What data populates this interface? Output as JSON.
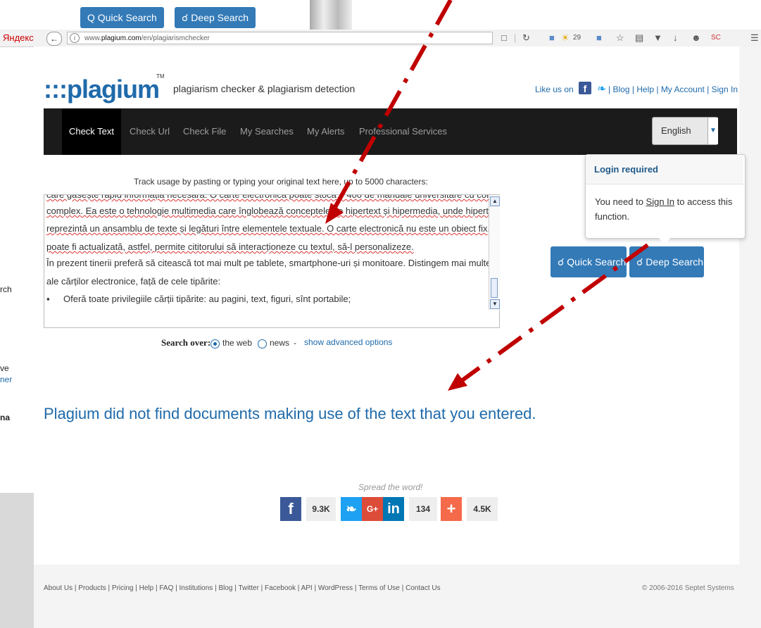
{
  "background": {
    "top_buttons": [
      "Q Quick Search",
      "Deep Search"
    ],
    "left_fragments": [
      "rch",
      "ve",
      "ner",
      "na"
    ]
  },
  "browser": {
    "yandex": "Яндекс",
    "url_prefix": "www.",
    "url_domain": "plagium.com",
    "url_path": "/en/plagiarismchecker",
    "weather": "29"
  },
  "header": {
    "logo": ":::plagium",
    "tm": "TM",
    "tagline": "plagiarism checker & plagiarism detection",
    "like_us": "Like us on",
    "links": [
      "Blog",
      "Help",
      "My Account",
      "Sign In"
    ]
  },
  "nav": {
    "items": [
      "Check Text",
      "Check Url",
      "Check File",
      "My Searches",
      "My Alerts",
      "Professional Services"
    ],
    "language": "English"
  },
  "input": {
    "label": "Track usage by pasting or typing your original text here, up to 5000 characters:",
    "lines": [
      "care găsește rapid informația necesară. O carte electronică poate stoca o 400 de manuale universitare cu conținut",
      "complex. Ea este o tehnologie multimedia care înglobează conceptele de hipertext și hipermedia, unde hipertextul",
      "reprezintă un ansamblu de texte și legături între elementele textuale. O carte electronică nu este un obiect fix, ea",
      "poate fi actualizată, astfel, permite cititorului să interacționeze cu textul, să-l personalizeze.",
      "În prezent tinerii preferă să citească tot mai mult pe tablete, smartphone-uri și monitoare. Distingem mai multe avantaje",
      "ale cărților electronice, față de cele tipărite:",
      "Oferă toate privilegiile cărții tipărite: au pagini, text, figuri, sînt portabile;"
    ],
    "bullet": "▪"
  },
  "search_over": {
    "label": "Search over:",
    "option_web": "the web",
    "option_news": "news",
    "separator": "-",
    "advanced": "show advanced options"
  },
  "buttons": {
    "quick_search": "Quick Search",
    "deep_search": "Deep Search"
  },
  "popover": {
    "title": "Login required",
    "body_pre": "You need to ",
    "body_link": "Sign In",
    "body_post": " to access this function."
  },
  "result": "Plagium did not find documents making use of the text that you entered.",
  "share": {
    "spread": "Spread the word!",
    "facebook_count": "9.3K",
    "linkedin_count": "134",
    "plus_count": "4.5K"
  },
  "footer": {
    "links": "About Us | Products | Pricing | Help | FAQ | Institutions | Blog | Twitter | Facebook | API | WordPress | Terms of Use | Contact Us",
    "copyright": "© 2006-2016 Septet Systems"
  },
  "colors": {
    "brand": "#1f6aaa",
    "button": "#337ab7",
    "navbar": "#1b1b1b",
    "annotation_arrow": "#c00000"
  }
}
